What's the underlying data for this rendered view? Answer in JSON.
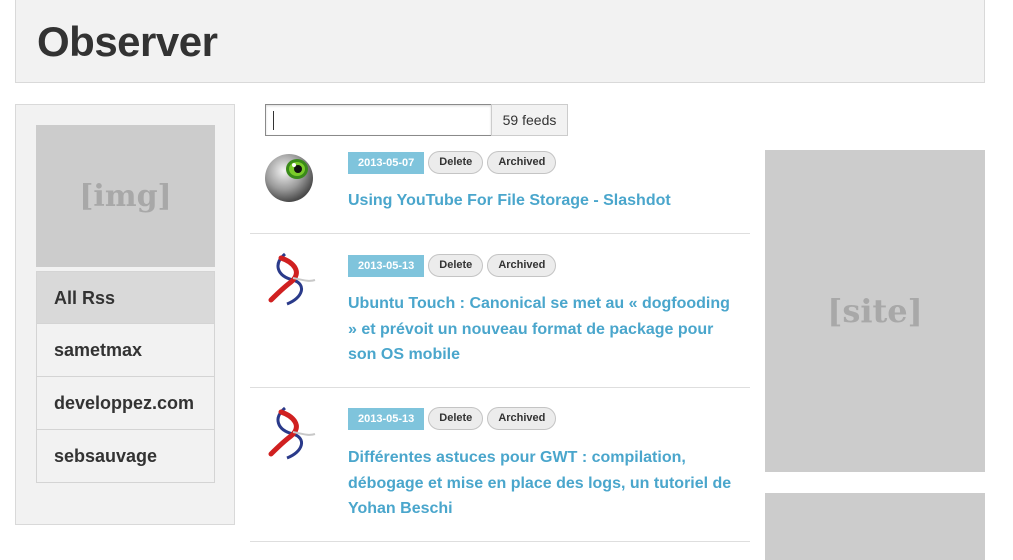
{
  "header": {
    "title": "Observer"
  },
  "sidebar": {
    "image_placeholder": "[img]",
    "items": [
      {
        "label": "All Rss"
      },
      {
        "label": "sametmax"
      },
      {
        "label": "developpez.com"
      },
      {
        "label": "sebsauvage"
      }
    ]
  },
  "search": {
    "value": "",
    "feed_count": "59 feeds"
  },
  "feeds": [
    {
      "date": "2013-05-07",
      "delete_label": "Delete",
      "archived_label": "Archived",
      "title": "Using YouTube For File Storage - Slashdot",
      "icon": "slashdot-eye-icon"
    },
    {
      "date": "2013-05-13",
      "delete_label": "Delete",
      "archived_label": "Archived",
      "title": "Ubuntu Touch : Canonical se met au « dogfooding » et prévoit un nouveau format de package pour son OS mobile",
      "icon": "developpez-swirl-icon"
    },
    {
      "date": "2013-05-13",
      "delete_label": "Delete",
      "archived_label": "Archived",
      "title": "Différentes astuces pour GWT : compilation, débogage et mise en place des logs, un tutoriel de Yohan Beschi",
      "icon": "developpez-swirl-icon"
    }
  ],
  "right_panel": {
    "site_placeholder": "[site]"
  },
  "colors": {
    "accent": "#4aa6cc",
    "date_badge": "#7fc4dc",
    "placeholder": "#cccccc"
  }
}
